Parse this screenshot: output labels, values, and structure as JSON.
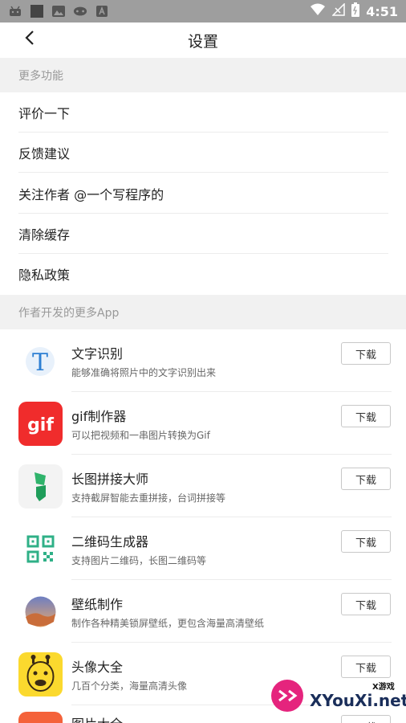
{
  "status_bar": {
    "time": "4:51",
    "icons": [
      "android-icon",
      "notification-icon",
      "image-icon",
      "gamepad-icon",
      "text-icon"
    ],
    "battery_color": "#ffffff"
  },
  "header": {
    "title": "设置",
    "back_icon": "chevron-left-icon"
  },
  "sections": {
    "more_functions": "更多功能",
    "more_apps": "作者开发的更多App"
  },
  "menu": [
    {
      "label": "评价一下"
    },
    {
      "label": "反馈建议"
    },
    {
      "label": "关注作者 @一个写程序的"
    },
    {
      "label": "清除缓存"
    },
    {
      "label": "隐私政策"
    }
  ],
  "apps": [
    {
      "name": "文字识别",
      "desc": "能够准确将照片中的文字识别出来",
      "button": "下载",
      "icon": "text-recognition-icon"
    },
    {
      "name": "gif制作器",
      "desc": "可以把视频和一串图片转换为Gif",
      "button": "下载",
      "icon": "gif-icon",
      "icon_label": "gif"
    },
    {
      "name": "长图拼接大师",
      "desc": "支持截屏智能去重拼接，台词拼接等",
      "button": "下载",
      "icon": "long-image-icon"
    },
    {
      "name": "二维码生成器",
      "desc": "支持图片二维码，长图二维码等",
      "button": "下载",
      "icon": "qr-code-icon"
    },
    {
      "name": "壁纸制作",
      "desc": "制作各种精美锁屏壁纸，更包含海量高清壁纸",
      "button": "下载",
      "icon": "wallpaper-icon"
    },
    {
      "name": "头像大全",
      "desc": "几百个分类，海量高清头像",
      "button": "下载",
      "icon": "giraffe-avatar-icon"
    },
    {
      "name": "图片大全",
      "desc": "",
      "button": "下载",
      "icon": "picture-icon"
    }
  ],
  "watermark": {
    "main": "XYouXi.net",
    "sub": "X游戏"
  },
  "colors": {
    "accent_red": "#f02c2c",
    "qr_green": "#2fb087",
    "header_bg": "#f1f1f1"
  }
}
